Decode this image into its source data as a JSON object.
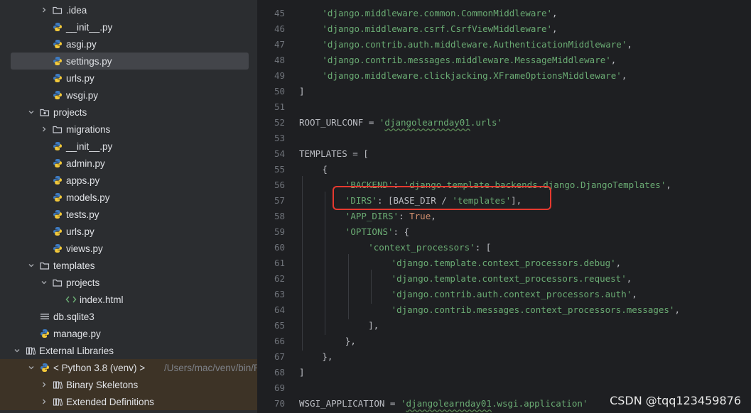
{
  "project_tree": [
    {
      "label": ".idea",
      "icon": "folder-icon",
      "indent": 2,
      "chevron": "right"
    },
    {
      "label": "__init__.py",
      "icon": "python-file-icon",
      "indent": 2
    },
    {
      "label": "asgi.py",
      "icon": "python-file-icon",
      "indent": 2
    },
    {
      "label": "settings.py",
      "icon": "python-file-icon",
      "indent": 2,
      "selected": true
    },
    {
      "label": "urls.py",
      "icon": "python-file-icon",
      "indent": 2
    },
    {
      "label": "wsgi.py",
      "icon": "python-file-icon",
      "indent": 2
    },
    {
      "label": "projects",
      "icon": "package-icon",
      "indent": 1,
      "chevron": "down"
    },
    {
      "label": "migrations",
      "icon": "folder-icon",
      "indent": 2,
      "chevron": "right"
    },
    {
      "label": "__init__.py",
      "icon": "python-file-icon",
      "indent": 2
    },
    {
      "label": "admin.py",
      "icon": "python-file-icon",
      "indent": 2
    },
    {
      "label": "apps.py",
      "icon": "python-file-icon",
      "indent": 2
    },
    {
      "label": "models.py",
      "icon": "python-file-icon",
      "indent": 2
    },
    {
      "label": "tests.py",
      "icon": "python-file-icon",
      "indent": 2
    },
    {
      "label": "urls.py",
      "icon": "python-file-icon",
      "indent": 2
    },
    {
      "label": "views.py",
      "icon": "python-file-icon",
      "indent": 2
    },
    {
      "label": "templates",
      "icon": "folder-icon",
      "indent": 1,
      "chevron": "down"
    },
    {
      "label": "projects",
      "icon": "folder-icon",
      "indent": 2,
      "chevron": "down"
    },
    {
      "label": "index.html",
      "icon": "html-file-icon",
      "indent": 3
    },
    {
      "label": "db.sqlite3",
      "icon": "database-file-icon",
      "indent": 1
    },
    {
      "label": "manage.py",
      "icon": "python-file-icon",
      "indent": 1
    },
    {
      "label": "External Libraries",
      "icon": "library-icon",
      "indent": 0,
      "chevron": "down"
    },
    {
      "label": "< Python 3.8 (venv) >",
      "suffix": "/Users/mac/venv/bin/Py",
      "icon": "python-sdk-icon",
      "indent": 1,
      "chevron": "down",
      "highlighted": true
    },
    {
      "label": "Binary Skeletons",
      "icon": "library-icon",
      "indent": 2,
      "chevron": "right",
      "highlighted": true
    },
    {
      "label": "Extended Definitions",
      "icon": "library-icon",
      "indent": 2,
      "chevron": "right",
      "highlighted": true
    }
  ],
  "code_lines": [
    {
      "n": "45",
      "indent": 1,
      "tokens": [
        {
          "t": "s",
          "v": "'django.middleware.common.CommonMiddleware'"
        },
        {
          "t": "p",
          "v": ","
        }
      ]
    },
    {
      "n": "46",
      "indent": 1,
      "tokens": [
        {
          "t": "s",
          "v": "'django.middleware.csrf.CsrfViewMiddleware'"
        },
        {
          "t": "p",
          "v": ","
        }
      ]
    },
    {
      "n": "47",
      "indent": 1,
      "tokens": [
        {
          "t": "s",
          "v": "'django.contrib.auth.middleware.AuthenticationMiddleware'"
        },
        {
          "t": "p",
          "v": ","
        }
      ]
    },
    {
      "n": "48",
      "indent": 1,
      "tokens": [
        {
          "t": "s",
          "v": "'django.contrib.messages.middleware.MessageMiddleware'"
        },
        {
          "t": "p",
          "v": ","
        }
      ]
    },
    {
      "n": "49",
      "indent": 1,
      "tokens": [
        {
          "t": "s",
          "v": "'django.middleware.clickjacking.XFrameOptionsMiddleware'"
        },
        {
          "t": "p",
          "v": ","
        }
      ]
    },
    {
      "n": "50",
      "indent": 0,
      "tokens": [
        {
          "t": "p",
          "v": "]"
        }
      ]
    },
    {
      "n": "51",
      "indent": 0,
      "tokens": []
    },
    {
      "n": "52",
      "indent": 0,
      "tokens": [
        {
          "t": "p",
          "v": "ROOT_URLCONF = "
        },
        {
          "t": "s",
          "v": "'"
        },
        {
          "t": "sq",
          "v": "djangolearnday01"
        },
        {
          "t": "s",
          "v": ".urls'"
        }
      ]
    },
    {
      "n": "53",
      "indent": 0,
      "tokens": []
    },
    {
      "n": "54",
      "indent": 0,
      "tokens": [
        {
          "t": "p",
          "v": "TEMPLATES = ["
        }
      ]
    },
    {
      "n": "55",
      "indent": 1,
      "tokens": [
        {
          "t": "p",
          "v": "{"
        }
      ]
    },
    {
      "n": "56",
      "indent": 2,
      "tokens": [
        {
          "t": "s",
          "v": "'BACKEND'"
        },
        {
          "t": "p",
          "v": ": "
        },
        {
          "t": "s",
          "v": "'django.template.backends.django.DjangoTemplates'"
        },
        {
          "t": "p",
          "v": ","
        }
      ]
    },
    {
      "n": "57",
      "indent": 2,
      "tokens": [
        {
          "t": "s",
          "v": "'DIRS'"
        },
        {
          "t": "p",
          "v": ": [BASE_DIR / "
        },
        {
          "t": "s",
          "v": "'templates'"
        },
        {
          "t": "p",
          "v": "],"
        }
      ]
    },
    {
      "n": "58",
      "indent": 2,
      "tokens": [
        {
          "t": "s",
          "v": "'APP_DIRS'"
        },
        {
          "t": "p",
          "v": ": "
        },
        {
          "t": "k",
          "v": "True"
        },
        {
          "t": "p",
          "v": ","
        }
      ]
    },
    {
      "n": "59",
      "indent": 2,
      "tokens": [
        {
          "t": "s",
          "v": "'OPTIONS'"
        },
        {
          "t": "p",
          "v": ": {"
        }
      ]
    },
    {
      "n": "60",
      "indent": 3,
      "tokens": [
        {
          "t": "s",
          "v": "'context_processors'"
        },
        {
          "t": "p",
          "v": ": ["
        }
      ]
    },
    {
      "n": "61",
      "indent": 4,
      "tokens": [
        {
          "t": "s",
          "v": "'django.template.context_processors.debug'"
        },
        {
          "t": "p",
          "v": ","
        }
      ]
    },
    {
      "n": "62",
      "indent": 4,
      "tokens": [
        {
          "t": "s",
          "v": "'django.template.context_processors.request'"
        },
        {
          "t": "p",
          "v": ","
        }
      ]
    },
    {
      "n": "63",
      "indent": 4,
      "tokens": [
        {
          "t": "s",
          "v": "'django.contrib.auth.context_processors.auth'"
        },
        {
          "t": "p",
          "v": ","
        }
      ]
    },
    {
      "n": "64",
      "indent": 4,
      "tokens": [
        {
          "t": "s",
          "v": "'django.contrib.messages.context_processors.messages'"
        },
        {
          "t": "p",
          "v": ","
        }
      ]
    },
    {
      "n": "65",
      "indent": 3,
      "tokens": [
        {
          "t": "p",
          "v": "],"
        }
      ]
    },
    {
      "n": "66",
      "indent": 2,
      "tokens": [
        {
          "t": "p",
          "v": "},"
        }
      ]
    },
    {
      "n": "67",
      "indent": 1,
      "tokens": [
        {
          "t": "p",
          "v": "},"
        }
      ]
    },
    {
      "n": "68",
      "indent": 0,
      "tokens": [
        {
          "t": "p",
          "v": "]"
        }
      ]
    },
    {
      "n": "69",
      "indent": 0,
      "tokens": []
    },
    {
      "n": "70",
      "indent": 0,
      "tokens": [
        {
          "t": "p",
          "v": "WSGI_APPLICATION = "
        },
        {
          "t": "s",
          "v": "'"
        },
        {
          "t": "sq",
          "v": "djangolearnday01"
        },
        {
          "t": "s",
          "v": ".wsgi.application'"
        }
      ]
    }
  ],
  "watermark": "CSDN @tqq123459876",
  "colors": {
    "sidebar_bg": "#2b2d30",
    "editor_bg": "#1e1f22",
    "string": "#6aab73",
    "keyword": "#cf8e6d",
    "highlight_box": "#e6392f"
  }
}
